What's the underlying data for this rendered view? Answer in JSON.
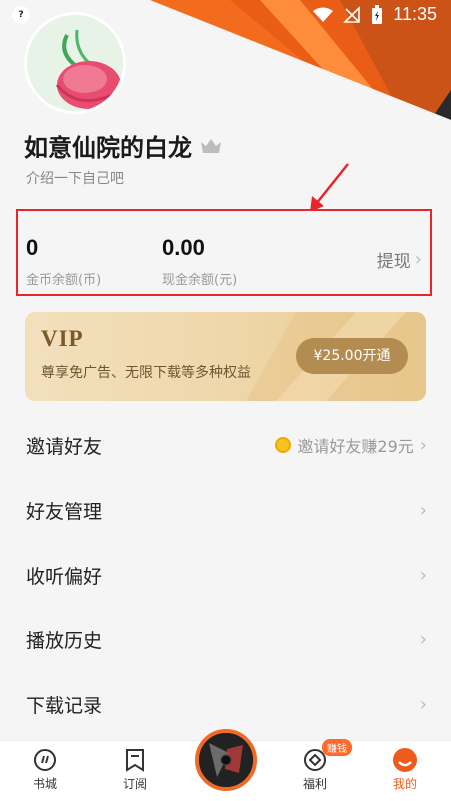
{
  "status_bar": {
    "time": "11:35"
  },
  "profile": {
    "name": "如意仙院的白龙",
    "bio": "介绍一下自己吧"
  },
  "wallet": {
    "coins_value": "0",
    "coins_label": "金币余额(币)",
    "cash_value": "0.00",
    "cash_label": "现金余额(元)",
    "withdraw_label": "提现"
  },
  "vip": {
    "title": "VIP",
    "description": "尊享免广告、无限下载等多种权益",
    "button": "¥25.00开通"
  },
  "menu": {
    "items": [
      {
        "label": "邀请好友",
        "extra": "邀请好友赚29元"
      },
      {
        "label": "好友管理"
      },
      {
        "label": "收听偏好"
      },
      {
        "label": "播放历史"
      },
      {
        "label": "下载记录"
      }
    ]
  },
  "tabbar": {
    "tabs": [
      {
        "label": "书城"
      },
      {
        "label": "订阅"
      },
      {
        "label": "福利",
        "badge": "赚钱"
      },
      {
        "label": "我的"
      }
    ]
  },
  "colors": {
    "accent": "#f05a1a",
    "annotation": "#e8242c",
    "vip_button": "#b38c52"
  },
  "icons": [
    "cast-icon",
    "wifi-icon",
    "no-signal-icon",
    "battery-icon",
    "crown-icon",
    "chevron-right-icon",
    "coin-icon",
    "book-city-icon",
    "subscribe-icon",
    "welfare-icon",
    "profile-icon"
  ]
}
